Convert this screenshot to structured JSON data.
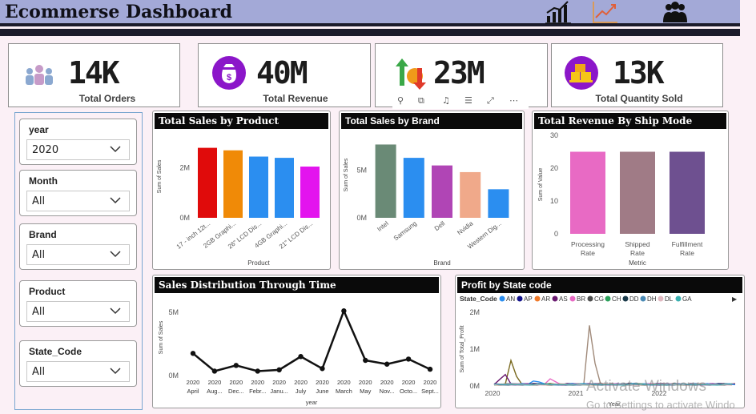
{
  "header": {
    "title": "Ecommerse Dashboard"
  },
  "kpis": [
    {
      "value": "14K",
      "label": "Total Orders"
    },
    {
      "value": "40M",
      "label": "Total Revenue"
    },
    {
      "value": "23M",
      "label": ""
    },
    {
      "value": "13K",
      "label": "Total Quantity Sold"
    }
  ],
  "slicers": [
    {
      "title": "year",
      "value": "2020"
    },
    {
      "title": "Month",
      "value": "All"
    },
    {
      "title": "Brand",
      "value": "All"
    },
    {
      "title": "Product",
      "value": "All"
    },
    {
      "title": "State_Code",
      "value": "All"
    }
  ],
  "toolbar": {
    "icons": [
      "pin-icon",
      "copy-icon",
      "bell-icon",
      "filter-icon",
      "focus-icon",
      "more-icon"
    ]
  },
  "watermark": {
    "line1": "Activate Windows",
    "line2": "Go to Settings to activate Windo"
  },
  "charts": {
    "sales_by_product": {
      "title": "Total Sales by Product",
      "chart_data": {
        "type": "bar",
        "categories": [
          "17 - inch 12t...",
          "2GB Graphi...",
          "26\" LCD Dis...",
          "4GB Graphi...",
          "21\" LCD Dis..."
        ],
        "values": [
          2.8,
          2.7,
          2.45,
          2.4,
          2.05
        ],
        "colors": [
          "#e00b0b",
          "#f08a07",
          "#2b8ef0",
          "#2b8ef0",
          "#e314ee"
        ],
        "xlabel": "Product",
        "ylabel": "Sum of Sales",
        "yticks": [
          "0M",
          "2M"
        ],
        "ylim": [
          0,
          3.3
        ]
      }
    },
    "sales_by_brand": {
      "title": "Total Sales by Brand",
      "chart_data": {
        "type": "bar",
        "categories": [
          "Intel",
          "Samsung",
          "Dell",
          "Nvidia",
          "Western Dig..."
        ],
        "values": [
          7.7,
          6.3,
          5.5,
          4.8,
          3.0
        ],
        "colors": [
          "#6a8a76",
          "#2b8ef0",
          "#b045b5",
          "#f0a98a",
          "#2b8ef0"
        ],
        "xlabel": "Brand",
        "ylabel": "Sum of Sales",
        "yticks": [
          "0M",
          "5M"
        ],
        "ylim": [
          0,
          9
        ]
      }
    },
    "revenue_by_ship": {
      "title": "Total Revenue By Ship Mode",
      "chart_data": {
        "type": "bar",
        "categories": [
          "Processing Rate",
          "Shipped Rate",
          "Fulfillment Rate"
        ],
        "values": [
          25,
          25,
          25
        ],
        "colors": [
          "#e86ac4",
          "#a07b86",
          "#6e5090"
        ],
        "xlabel": "Metric",
        "ylabel": "Sum of Value",
        "yticks": [
          "0",
          "10",
          "20",
          "30"
        ],
        "ylim": [
          0,
          30
        ]
      }
    },
    "sales_over_time": {
      "title": "Sales Distribution Through Time",
      "chart_data": {
        "type": "line",
        "categories": [
          "2020 April",
          "2020 Aug...",
          "2020 Dec...",
          "2020 Febr...",
          "2020 Janu...",
          "2020 July",
          "2020 June",
          "2020 March",
          "2020 May",
          "2020 Nov...",
          "2020 Octo...",
          "2020 Sept..."
        ],
        "values": [
          1.75,
          0.35,
          0.8,
          0.35,
          0.45,
          1.5,
          0.55,
          5.1,
          1.2,
          0.9,
          1.3,
          0.5
        ],
        "xlabel": "year",
        "ylabel": "Sum of Sales",
        "yticks": [
          "0M",
          "5M"
        ],
        "ylim": [
          0,
          6
        ]
      }
    },
    "profit_by_state": {
      "title": "Profit by State code",
      "legend_label": "State_Code",
      "legend": [
        {
          "name": "AN",
          "color": "#2b8ef0"
        },
        {
          "name": "AP",
          "color": "#14148c"
        },
        {
          "name": "AR",
          "color": "#f07a2a"
        },
        {
          "name": "AS",
          "color": "#6a1a70"
        },
        {
          "name": "BR",
          "color": "#e86ac4"
        },
        {
          "name": "CG",
          "color": "#4d4d4d"
        },
        {
          "name": "CH",
          "color": "#2ba05a"
        },
        {
          "name": "DD",
          "color": "#1a3a4a"
        },
        {
          "name": "DH",
          "color": "#4a8ab5"
        },
        {
          "name": "DL",
          "color": "#e0b8c0"
        },
        {
          "name": "GA",
          "color": "#3ab0b0"
        }
      ],
      "chart_data": {
        "type": "line",
        "xticks": [
          "2020",
          "2021",
          "2022"
        ],
        "xlabel": "Year",
        "ylabel": "Sum of Total_Profit",
        "yticks": [
          "0M",
          "1M",
          "2M"
        ],
        "ylim": [
          0,
          2
        ]
      }
    }
  }
}
